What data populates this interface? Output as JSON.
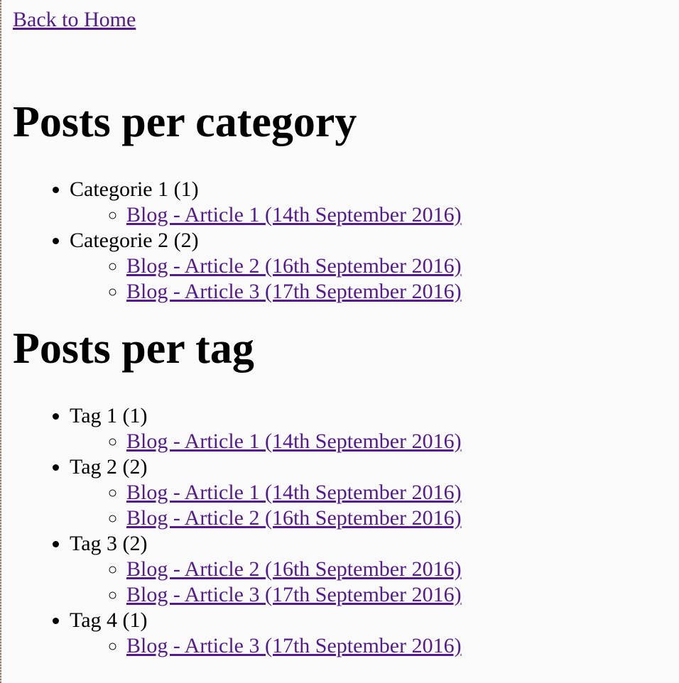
{
  "nav": {
    "back_label": "Back to Home"
  },
  "sections": {
    "categories": {
      "title": "Posts per category",
      "groups": [
        {
          "label": "Categorie 1 (1)",
          "posts": [
            "Blog - Article 1 (14th September 2016)"
          ]
        },
        {
          "label": "Categorie 2 (2)",
          "posts": [
            "Blog - Article 2 (16th September 2016)",
            "Blog - Article 3 (17th September 2016)"
          ]
        }
      ]
    },
    "tags": {
      "title": "Posts per tag",
      "groups": [
        {
          "label": "Tag 1 (1)",
          "posts": [
            "Blog - Article 1 (14th September 2016)"
          ]
        },
        {
          "label": "Tag 2 (2)",
          "posts": [
            "Blog - Article 1 (14th September 2016)",
            "Blog - Article 2 (16th September 2016)"
          ]
        },
        {
          "label": "Tag 3 (2)",
          "posts": [
            "Blog - Article 2 (16th September 2016)",
            "Blog - Article 3 (17th September 2016)"
          ]
        },
        {
          "label": "Tag 4 (1)",
          "posts": [
            "Blog - Article 3 (17th September 2016)"
          ]
        }
      ]
    }
  },
  "colors": {
    "link": "#551a8b",
    "background": "#fafafa"
  }
}
